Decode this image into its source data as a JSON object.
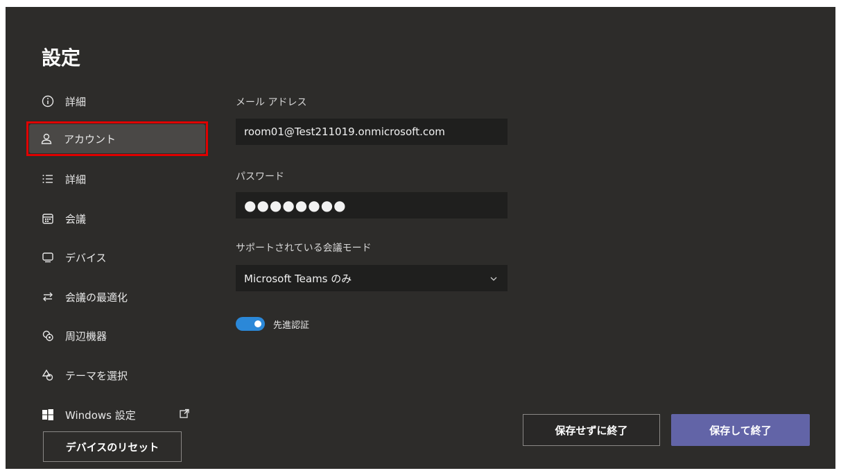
{
  "page": {
    "title": "設定"
  },
  "nav": {
    "items": [
      {
        "label": "詳細",
        "icon": "info-icon"
      },
      {
        "label": "アカウント",
        "icon": "person-icon"
      },
      {
        "label": "詳細",
        "icon": "list-icon"
      },
      {
        "label": "会議",
        "icon": "calendar-icon"
      },
      {
        "label": "デバイス",
        "icon": "monitor-icon"
      },
      {
        "label": "会議の最適化",
        "icon": "swap-arrows-icon"
      },
      {
        "label": "周辺機器",
        "icon": "peripherals-icon"
      },
      {
        "label": "テーマを選択",
        "icon": "shapes-icon"
      },
      {
        "label": "Windows 設定",
        "icon": "windows-logo-icon"
      }
    ],
    "selected_index": 1,
    "reset_label": "デバイスのリセット"
  },
  "form": {
    "email_label": "メール アドレス",
    "email_value": "room01@Test211019.onmicrosoft.com",
    "password_label": "パスワード",
    "password_value": "●●●●●●●●",
    "mode_label": "サポートされている会議モード",
    "mode_value": "Microsoft Teams のみ",
    "toggle_label": "先進認証",
    "toggle_on": true
  },
  "footer": {
    "cancel_label": "保存せずに終了",
    "save_label": "保存して終了"
  },
  "colors": {
    "background": "#2d2c2a",
    "accent_primary": "#6264a7",
    "toggle_on": "#2b88d8",
    "selection_outline": "#e00000"
  }
}
